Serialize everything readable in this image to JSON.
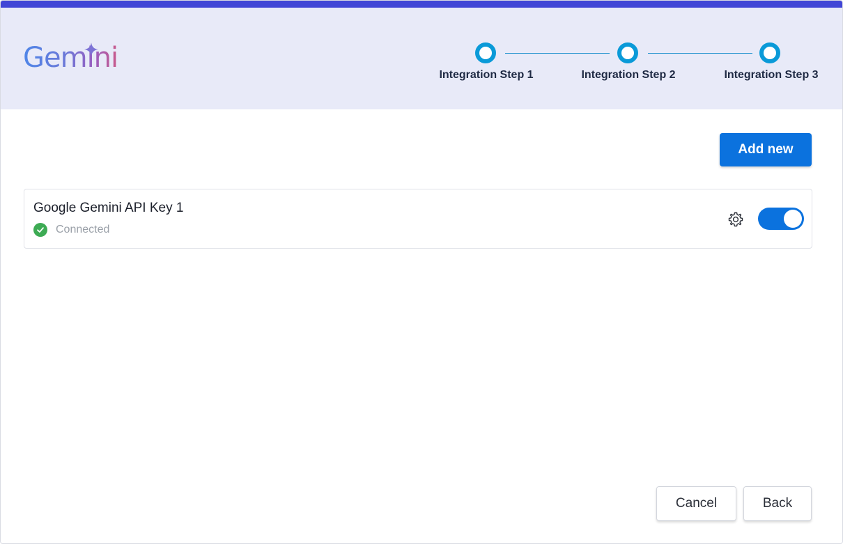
{
  "header": {
    "logo_text": "Gemini",
    "steps": [
      {
        "label": "Integration Step 1"
      },
      {
        "label": "Integration Step 2"
      },
      {
        "label": "Integration Step 3"
      }
    ]
  },
  "toolbar": {
    "add_label": "Add new"
  },
  "integrations": [
    {
      "name": "Google Gemini API Key 1",
      "status": "Connected",
      "enabled": true
    }
  ],
  "footer": {
    "cancel_label": "Cancel",
    "back_label": "Back"
  },
  "colors": {
    "accent": "#0b72de",
    "top_bar": "#4146d6",
    "header_bg": "#e8eaf8",
    "step_ring": "#0a9ad8",
    "success": "#3dab54"
  },
  "icons": [
    "gemini-spark-icon",
    "check-circle-icon",
    "gear-icon"
  ]
}
